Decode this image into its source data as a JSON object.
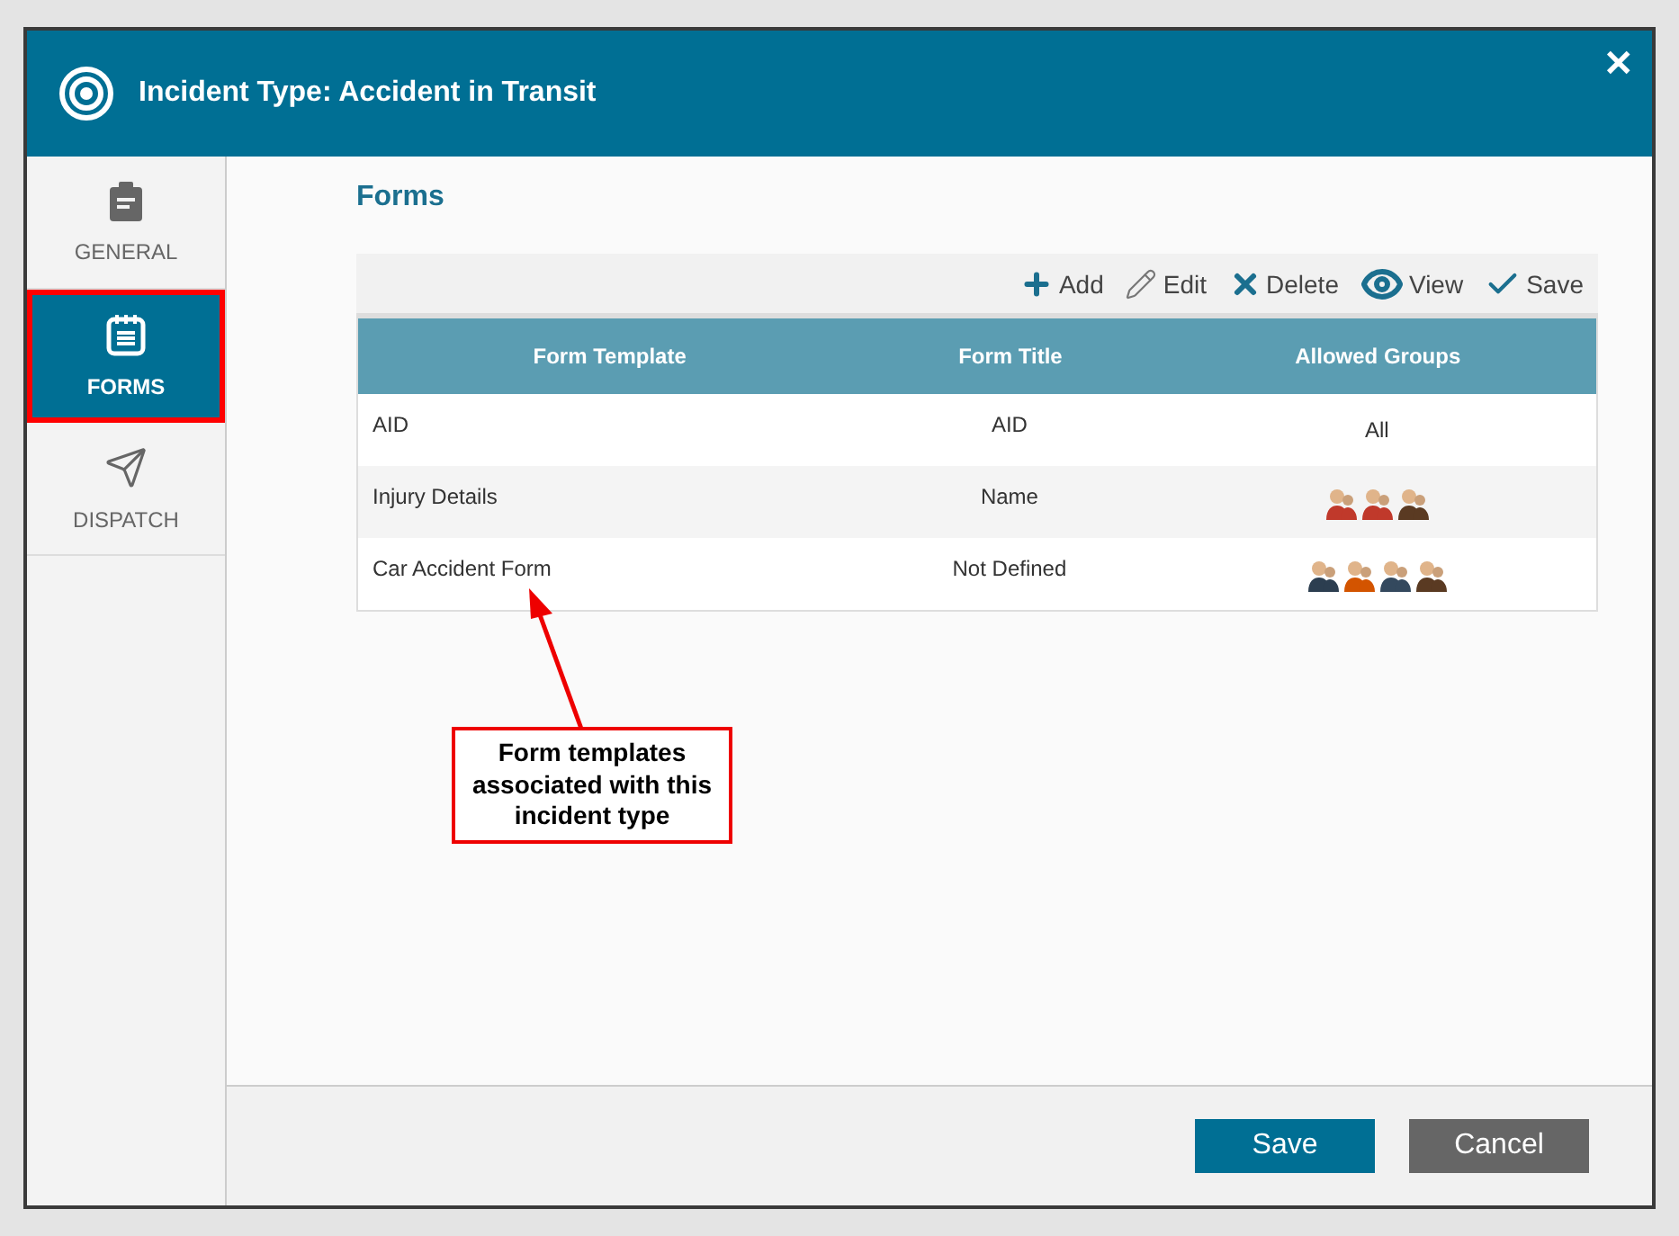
{
  "window": {
    "title": "Incident Type: Accident in Transit",
    "close": "✕"
  },
  "sidebar": {
    "items": [
      {
        "label": "GENERAL",
        "kind": "clipboard",
        "selected": false
      },
      {
        "label": "FORMS",
        "kind": "notepad",
        "selected": true
      },
      {
        "label": "DISPATCH",
        "kind": "send",
        "selected": false
      }
    ]
  },
  "section_title": "Forms",
  "toolbar": [
    {
      "label": "Add",
      "kind": "add"
    },
    {
      "label": "Edit",
      "kind": "edit"
    },
    {
      "label": "Delete",
      "kind": "delete"
    },
    {
      "label": "View",
      "kind": "view"
    },
    {
      "label": "Save",
      "kind": "save"
    }
  ],
  "table": {
    "columns": [
      "Form Template",
      "Form Title",
      "Allowed Groups"
    ],
    "rows": [
      {
        "template": "AID",
        "title": "AID",
        "groups_text": "All"
      },
      {
        "template": "Injury Details",
        "title": "Name",
        "groups": [
          {
            "color": "#c0392b"
          },
          {
            "color": "#c0392b"
          },
          {
            "color": "#5a3a22"
          }
        ]
      },
      {
        "template": "Car Accident Form",
        "title": "Not Defined",
        "groups": [
          {
            "color": "#2c3e50"
          },
          {
            "color": "#d35400"
          },
          {
            "color": "#34495e"
          },
          {
            "color": "#5a3a22"
          }
        ]
      }
    ]
  },
  "annotation": "Form templates associated with this incident type",
  "buttons": [
    {
      "label": "Save",
      "kind": "primary"
    },
    {
      "label": "Cancel",
      "kind": "secondary"
    }
  ]
}
